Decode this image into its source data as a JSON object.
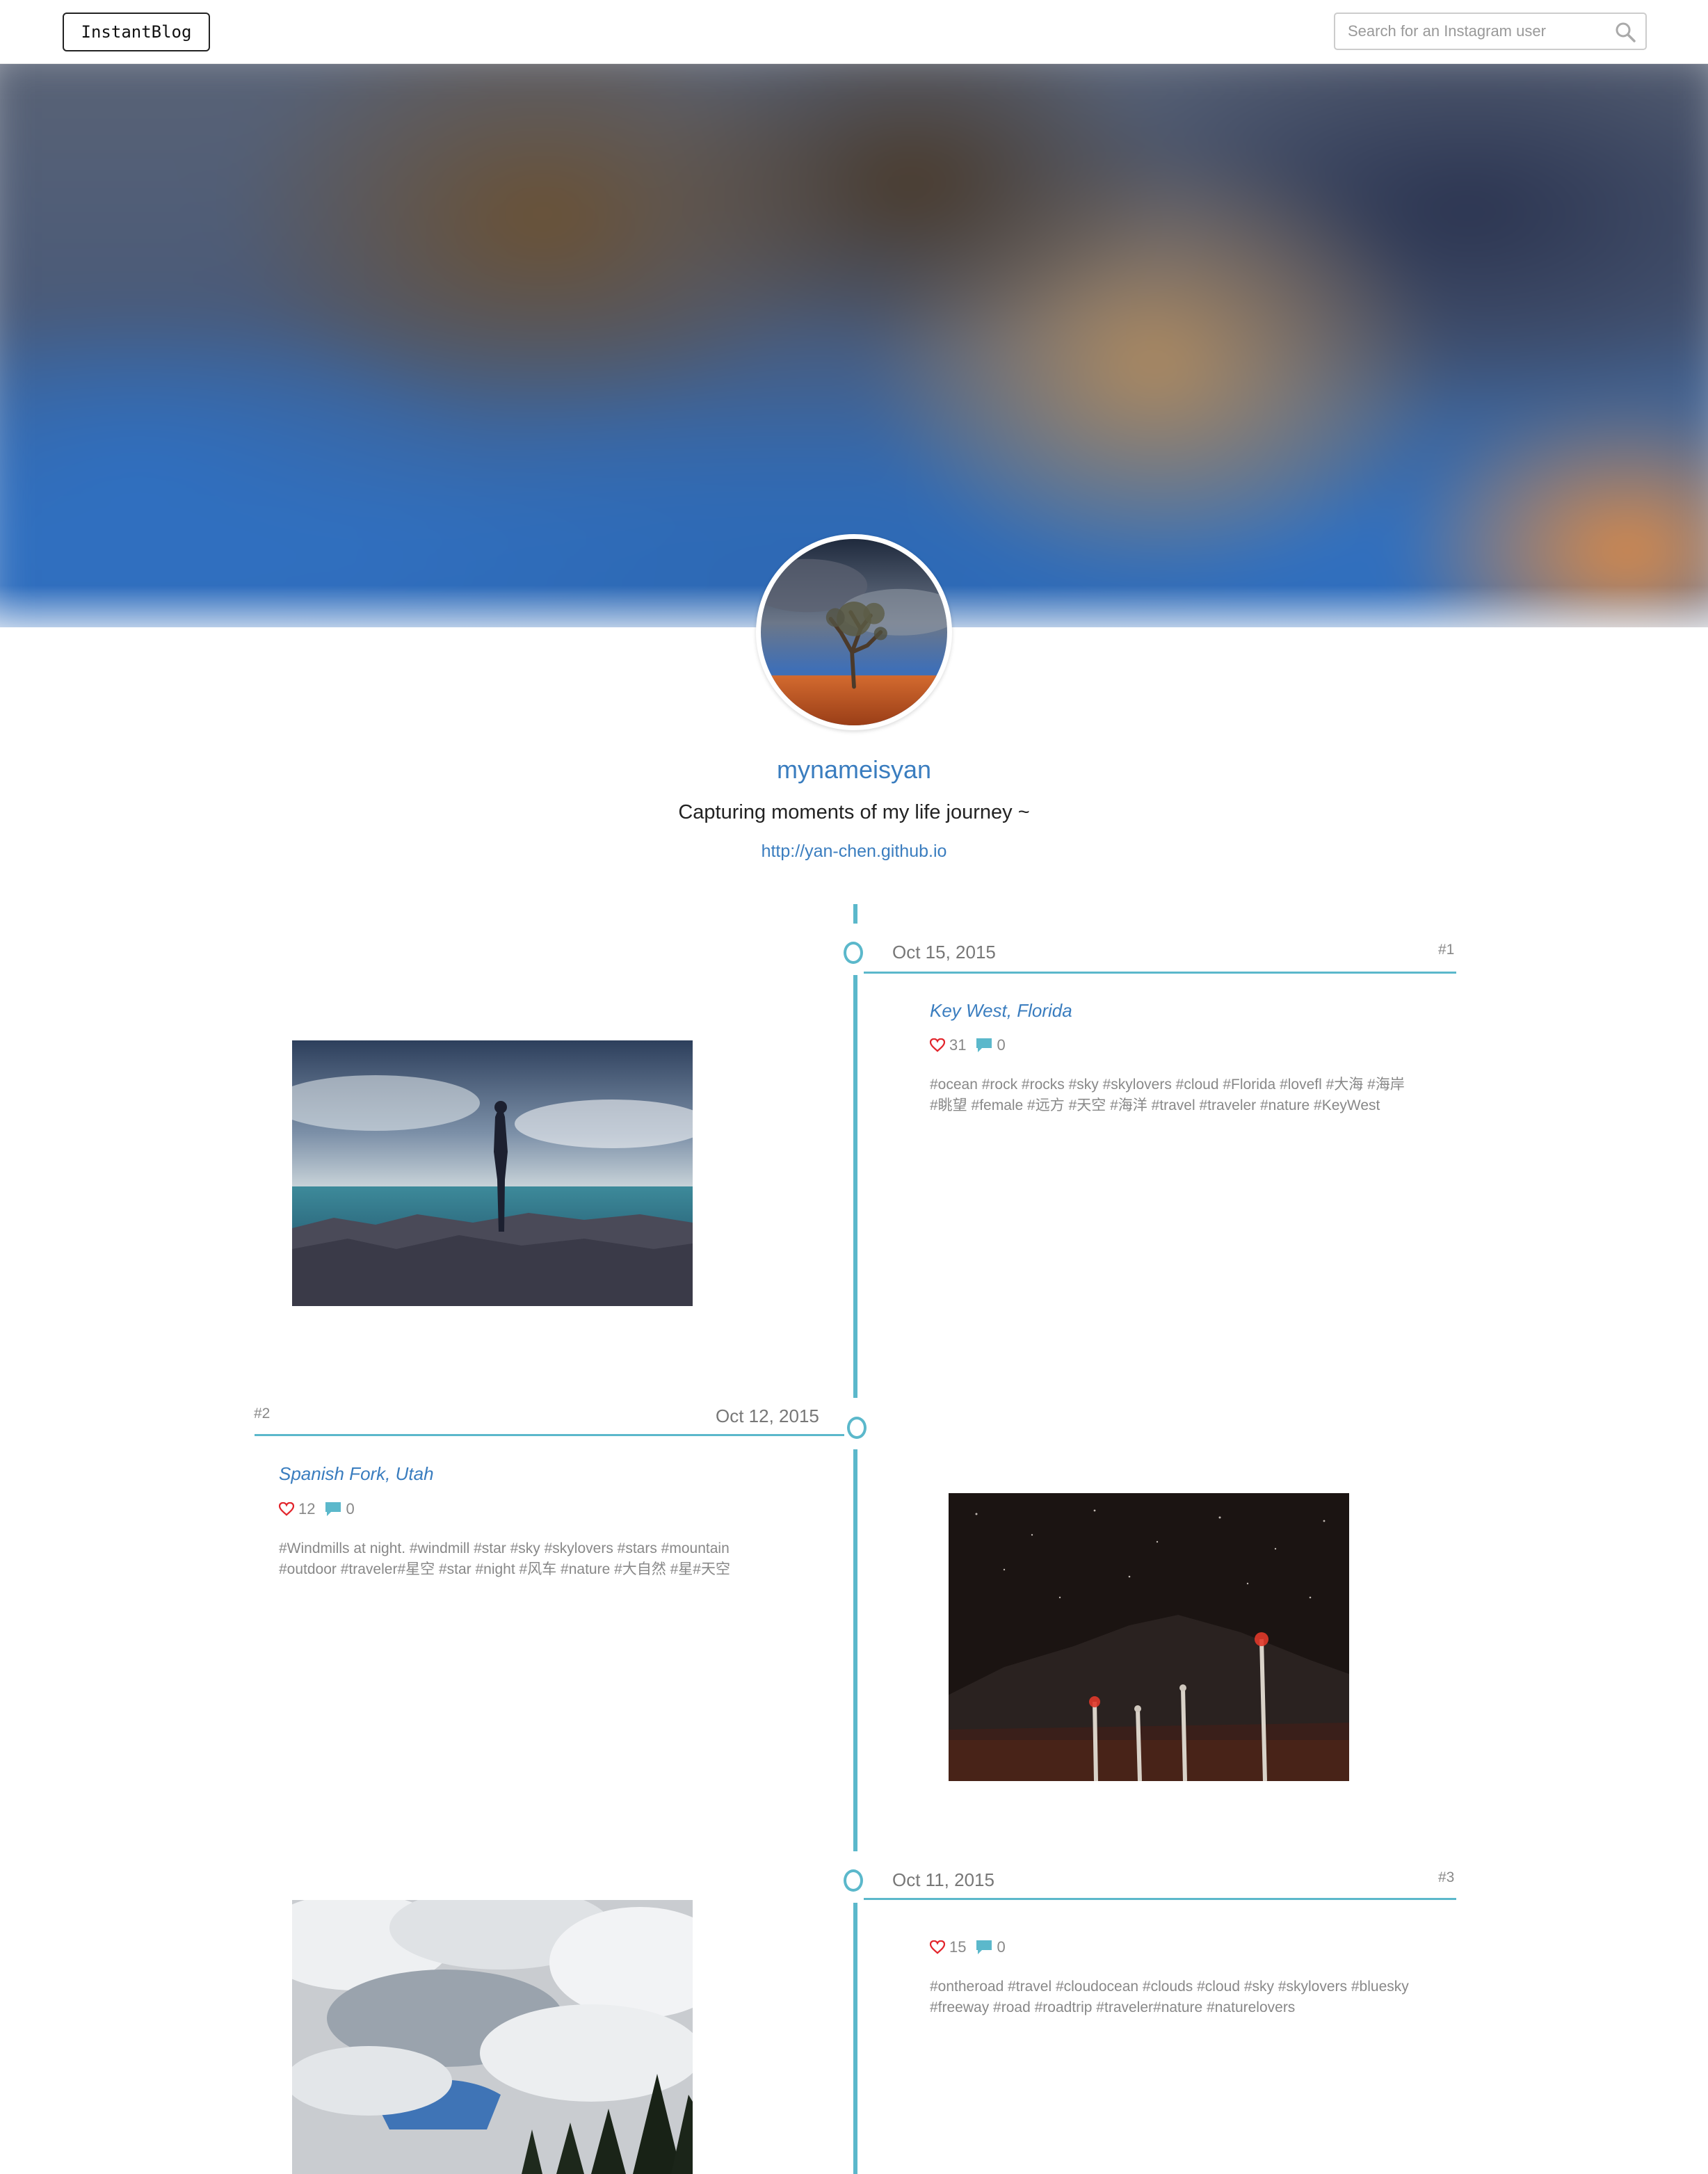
{
  "navbar": {
    "brand": "InstantBlog",
    "search_placeholder": "Search for an Instagram user"
  },
  "profile": {
    "username": "mynameisyan",
    "bio": "Capturing moments of my life journey ~",
    "website": "http://yan-chen.github.io"
  },
  "icons": {
    "search": "search-icon",
    "like": "heart-icon",
    "comment": "comment-icon"
  },
  "colors": {
    "accent": "#5bb8cb",
    "link": "#3a7dbf",
    "like": "#e2242b"
  },
  "posts": [
    {
      "number": "#1",
      "date": "Oct 15, 2015",
      "location": "Key West, Florida",
      "likes": "31",
      "comments": "0",
      "caption_line1": "#ocean #rock #rocks #sky #skylovers #cloud #Florida #lovefl #大海 #海岸",
      "caption_line2": "#眺望 #female #远方 #天空 #海洋 #travel #traveler #nature #KeyWest"
    },
    {
      "number": "#2",
      "date": "Oct 12, 2015",
      "location": "Spanish Fork, Utah",
      "likes": "12",
      "comments": "0",
      "caption_line1": "#Windmills at night. #windmill #star #sky #skylovers #stars #mountain",
      "caption_line2": "#outdoor #traveler#星空 #star #night #风车 #nature #大自然 #星#天空"
    },
    {
      "number": "#3",
      "date": "Oct 11, 2015",
      "location": "",
      "likes": "15",
      "comments": "0",
      "caption_line1": "#ontheroad #travel #cloudocean #clouds #cloud #sky #skylovers #bluesky",
      "caption_line2": "#freeway #road #roadtrip #traveler#nature #naturelovers"
    }
  ]
}
